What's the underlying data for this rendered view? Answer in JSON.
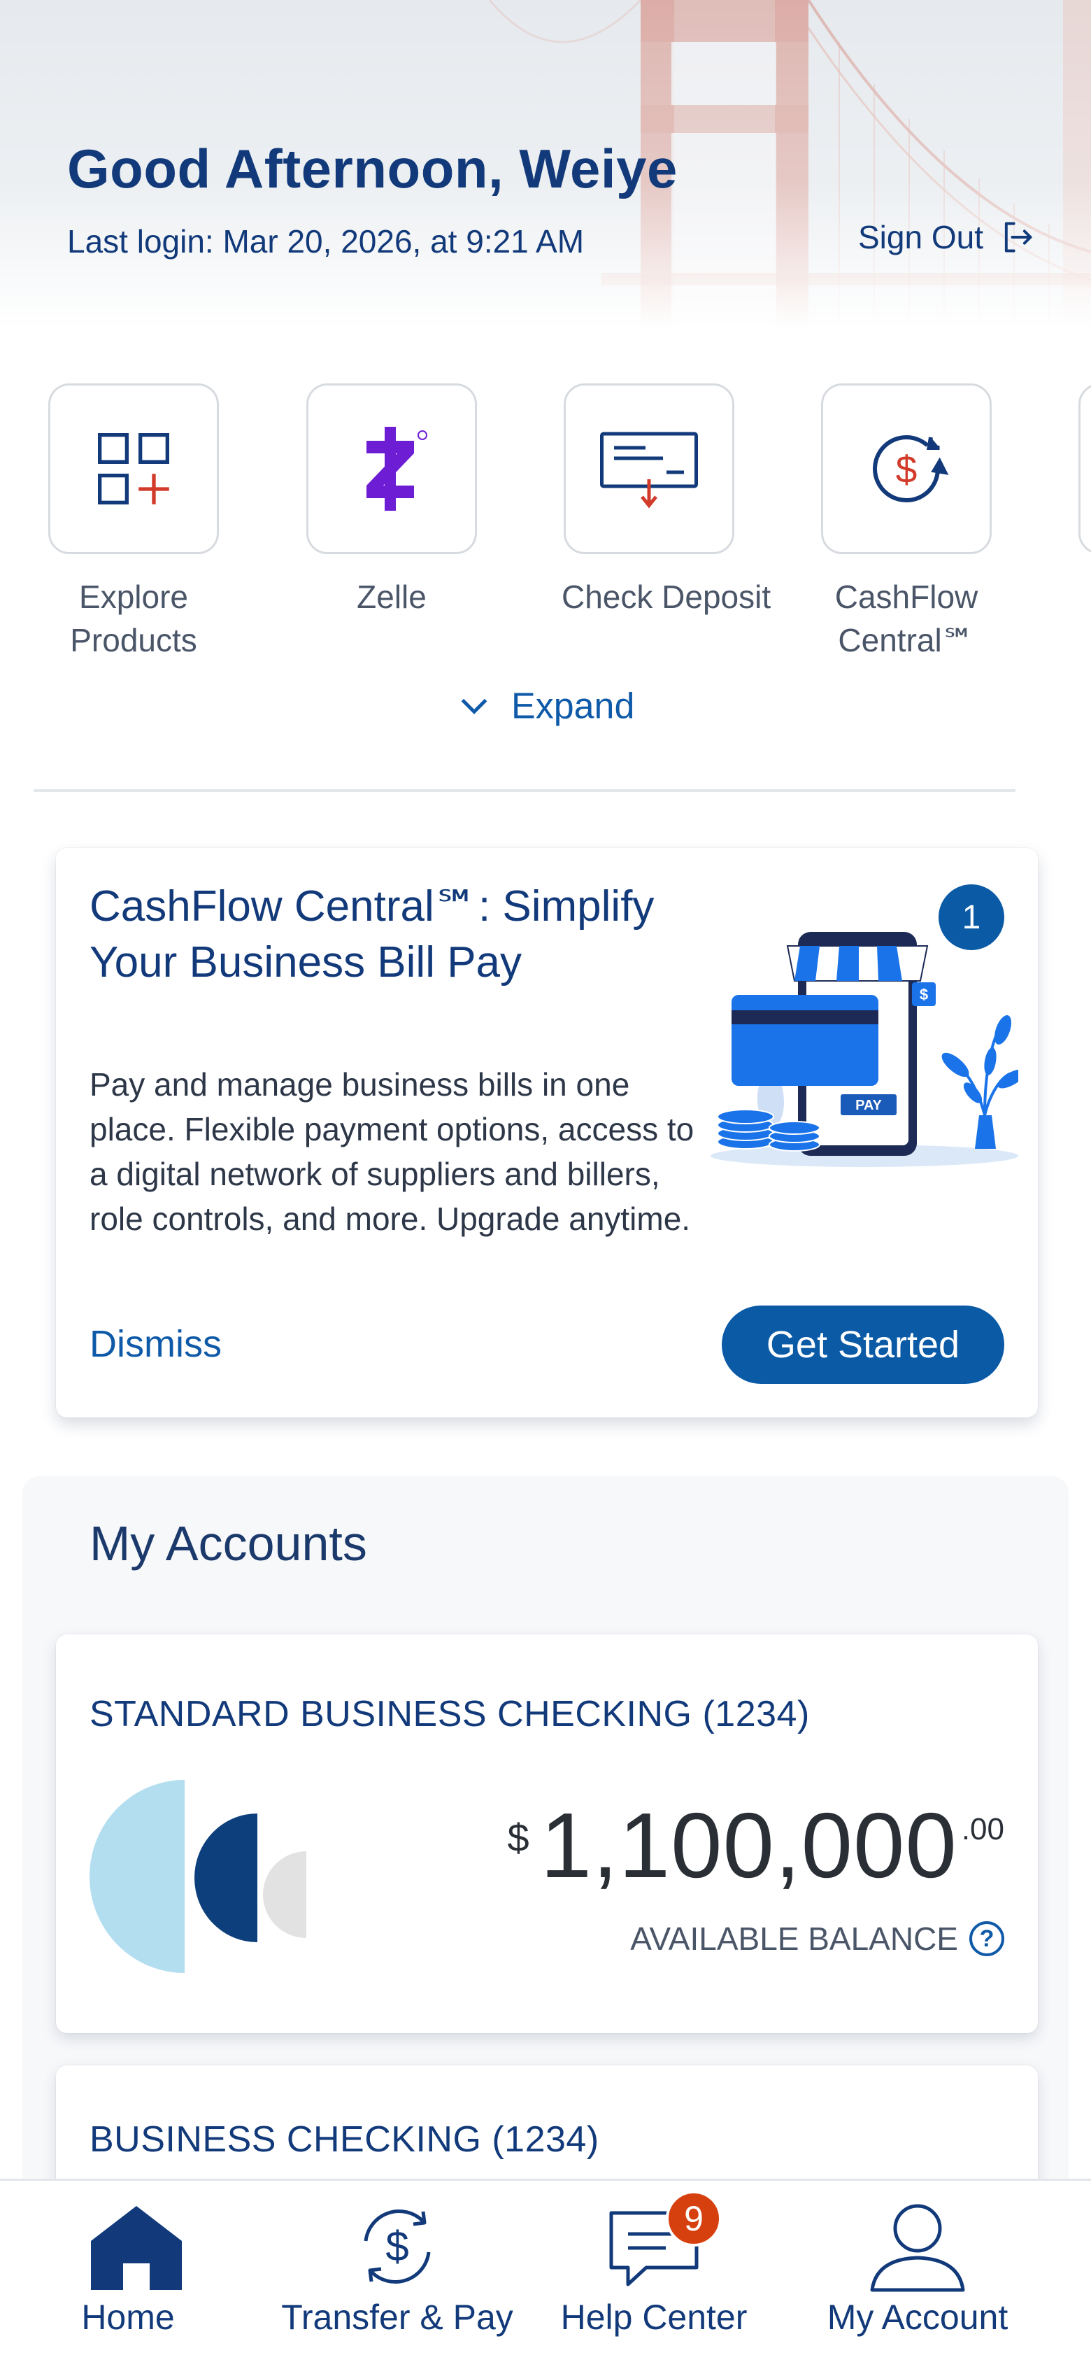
{
  "header": {
    "greeting": "Good Afternoon, Weiye",
    "last_login": "Last login: Mar 20, 2026, at 9:21 AM",
    "sign_out": "Sign Out"
  },
  "quick_actions": {
    "items": [
      {
        "label_line1": "Explore",
        "label_line2": "Products",
        "icon": "explore-products-icon"
      },
      {
        "label_line1": "Zelle",
        "label_line2": "",
        "icon": "zelle-icon"
      },
      {
        "label_line1": "Check Deposit",
        "label_line2": "",
        "icon": "check-deposit-icon"
      },
      {
        "label_line1": "CashFlow",
        "label_line2": "Central℠",
        "icon": "cashflow-icon"
      }
    ],
    "expand_label": "Expand"
  },
  "promo": {
    "title": "CashFlow Central℠: Simplify Your Business Bill Pay",
    "body": "Pay and manage business bills in one place. Flexible payment options, access to a digital network of suppliers and billers, role controls, and more. Upgrade anytime.",
    "badge_count": "1",
    "art_pay_label": "PAY",
    "dismiss_label": "Dismiss",
    "cta_label": "Get Started"
  },
  "accounts": {
    "section_title": "My Accounts",
    "list": [
      {
        "name": "STANDARD BUSINESS CHECKING (1234)",
        "currency_symbol": "$",
        "balance_whole": "1,100,000",
        "balance_cents": ".00",
        "balance_label": "AVAILABLE BALANCE"
      },
      {
        "name": "BUSINESS CHECKING (1234)"
      }
    ]
  },
  "bottom_nav": {
    "items": [
      {
        "label": "Home",
        "icon": "home-icon"
      },
      {
        "label": "Transfer & Pay",
        "icon": "transfer-pay-icon"
      },
      {
        "label": "Help Center",
        "icon": "chat-icon",
        "badge": "9"
      },
      {
        "label": "My Account",
        "icon": "person-icon"
      }
    ]
  },
  "colors": {
    "brand_navy": "#123a7a",
    "link_blue": "#0f5aa8",
    "button_blue": "#0a5aa6",
    "badge_red": "#d6400e",
    "zelle_purple": "#6d1ed4"
  }
}
